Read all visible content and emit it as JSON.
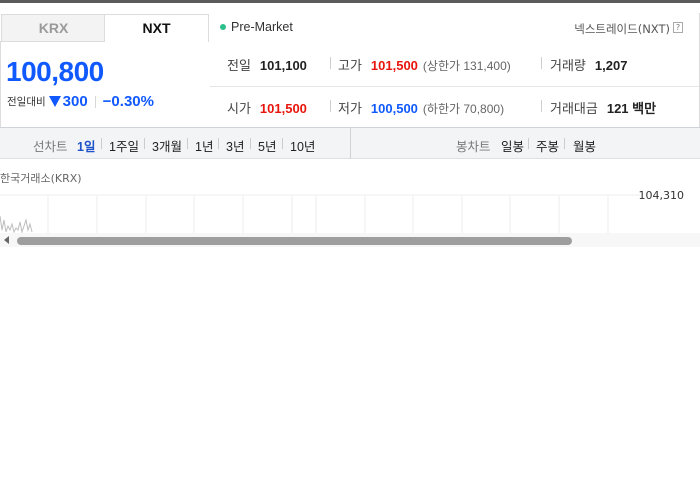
{
  "tabs": [
    {
      "label": "KRX",
      "active": false
    },
    {
      "label": "NXT",
      "active": true
    }
  ],
  "session": {
    "label": "Pre-Market",
    "color": "#2bbf8a"
  },
  "exchange": {
    "name": "넥스트레이드(NXT)",
    "help": "?"
  },
  "quote": {
    "price": "100,800",
    "change_label": "전일대비",
    "change_amount": "300",
    "change_percent": "−0.30%",
    "direction": "down",
    "down_color": "#1059ff",
    "up_color": "#e8150c"
  },
  "stats": {
    "prev_close": {
      "label": "전일",
      "value": "101,100"
    },
    "high": {
      "label": "고가",
      "value": "101,500",
      "sub": "(상한가 131,400)"
    },
    "volume": {
      "label": "거래량",
      "value": "1,207"
    },
    "open": {
      "label": "시가",
      "value": "101,500"
    },
    "low": {
      "label": "저가",
      "value": "100,500",
      "sub": "(하한가 70,800)"
    },
    "trade_value": {
      "label": "거래대금",
      "value": "121 백만"
    }
  },
  "toolbar": {
    "line_label": "선차트",
    "line_periods": [
      "1일",
      "1주일",
      "3개월",
      "1년",
      "3년",
      "5년",
      "10년"
    ],
    "active_period": "1일",
    "candle_label": "봉차트",
    "candle_periods": [
      "일봉",
      "주봉",
      "월봉"
    ]
  },
  "chart": {
    "source_label": "한국거래소(KRX)",
    "y_tick": "104,310"
  }
}
